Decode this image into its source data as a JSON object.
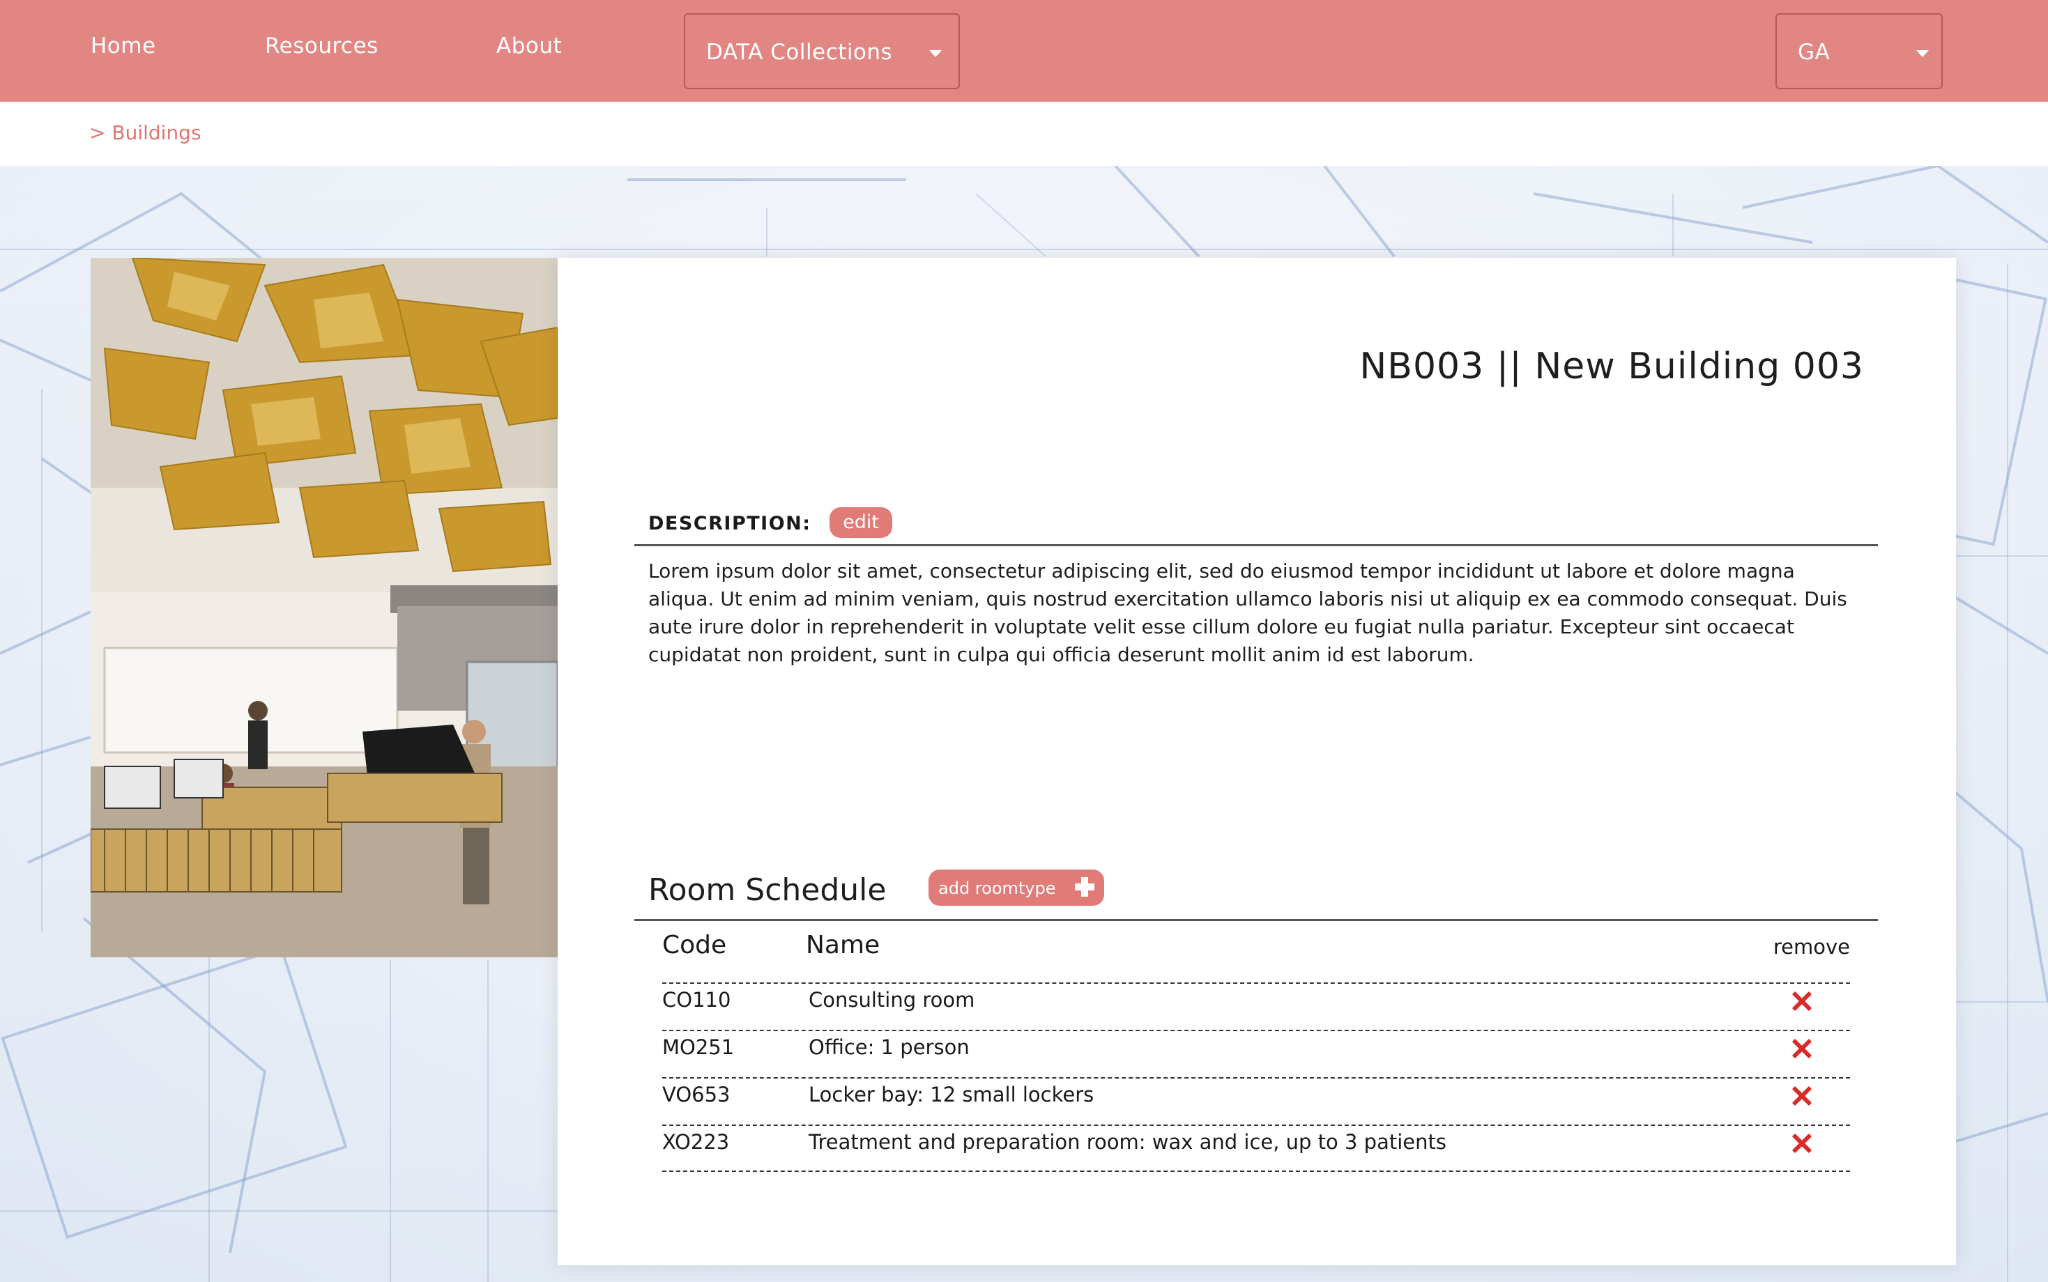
{
  "nav": {
    "home": "Home",
    "resources": "Resources",
    "about": "About",
    "collections_selected": "DATA Collections",
    "language_selected": "GA"
  },
  "breadcrumb": "> Buildings",
  "building": {
    "title": "NB003 || New Building 003"
  },
  "description": {
    "label": "DESCRIPTION:",
    "edit_label": "edit",
    "text": "Lorem ipsum dolor sit amet, consectetur adipiscing elit, sed do eiusmod tempor incididunt ut labore et dolore magna aliqua. Ut enim ad minim veniam, quis nostrud exercitation ullamco laboris nisi ut aliquip ex ea commodo consequat. Duis aute irure dolor in reprehenderit in voluptate velit esse cillum dolore eu fugiat nulla pariatur. Excepteur sint occaecat cupidatat non proident, sunt in culpa qui officia deserunt mollit anim id est laborum."
  },
  "room_schedule": {
    "title": "Room Schedule",
    "add_label": "add roomtype",
    "columns": {
      "code": "Code",
      "name": "Name",
      "remove": "remove"
    },
    "rows": [
      {
        "code": "CO110",
        "name": "Consulting room"
      },
      {
        "code": "MO251",
        "name": "Office: 1 person"
      },
      {
        "code": "VO653",
        "name": "Locker bay: 12 small lockers"
      },
      {
        "code": "XO223",
        "name": "Treatment and preparation room: wax and ice, up to 3 patients"
      }
    ]
  },
  "colors": {
    "nav_background": "#e28683",
    "accent": "#e07b78",
    "remove_icon": "#d92a25"
  },
  "icons": {
    "dropdown": "caret-down-icon",
    "add": "plus-icon",
    "remove": "close-x-icon"
  }
}
